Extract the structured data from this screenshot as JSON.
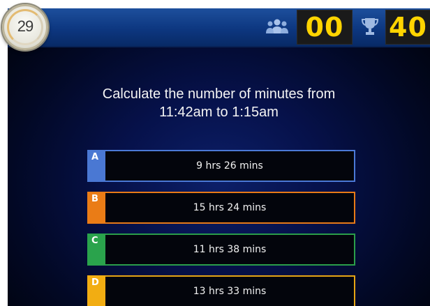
{
  "header": {
    "timer": "29",
    "players_icon": "players-icon",
    "players_count": "00",
    "trophy_icon": "trophy-icon",
    "score": "40"
  },
  "question": {
    "line1": "Calculate the number of minutes from",
    "line2": "11:42am to 1:15am"
  },
  "answers": [
    {
      "letter": "A",
      "text": "9 hrs 26 mins",
      "color": "#4a78d3"
    },
    {
      "letter": "B",
      "text": "15 hrs 24 mins",
      "color": "#ea7c16"
    },
    {
      "letter": "C",
      "text": "11 hrs 38 mins",
      "color": "#2aa34c"
    },
    {
      "letter": "D",
      "text": "13 hrs 33 mins",
      "color": "#f2ad12"
    }
  ],
  "colors": {
    "score_text": "#ffd400",
    "top_bar": "#0d3780",
    "background": "#06114a"
  }
}
